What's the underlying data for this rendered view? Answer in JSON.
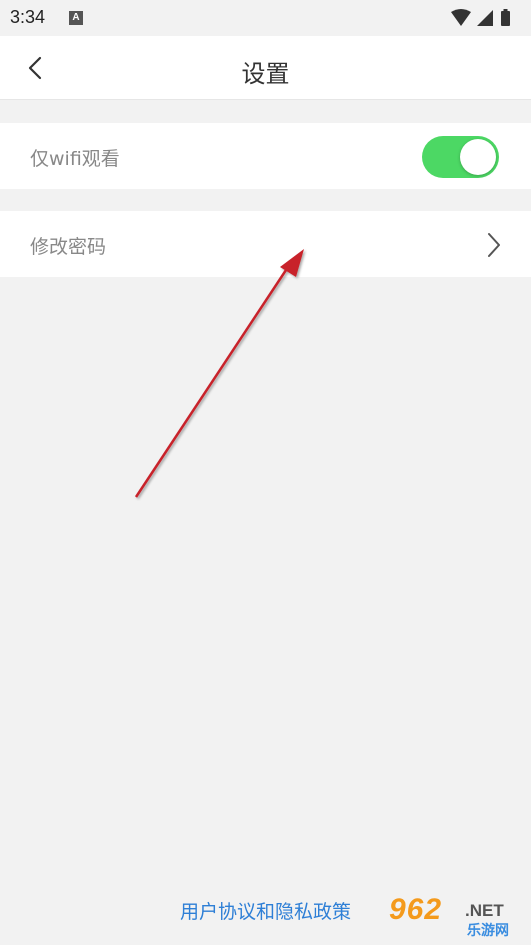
{
  "status_bar": {
    "time": "3:34",
    "notification_letter": "A"
  },
  "nav": {
    "title": "设置"
  },
  "settings": {
    "wifi_only_label": "仅wifi观看",
    "wifi_only_enabled": true,
    "change_password_label": "修改密码"
  },
  "footer": {
    "agreement_link": "用户协议和隐私政策"
  },
  "watermark": {
    "brand": "962",
    "domain": ".NET",
    "subtitle": "乐游网"
  },
  "colors": {
    "toggle_on": "#4cd864",
    "link": "#2e7fd6",
    "annotation_arrow": "#c8202a"
  }
}
